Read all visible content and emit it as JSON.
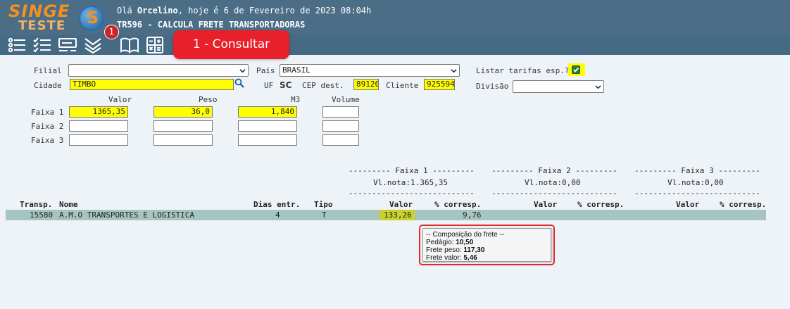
{
  "header": {
    "logo_line1": "SINGE",
    "logo_line2": "TESTE",
    "logo_letter": "S",
    "greeting_prefix": "Olá ",
    "user": "Orcelino",
    "greeting_suffix": ", hoje é 6 de Fevereiro de 2023 08:04h",
    "screen_title": "TR596 - CALCULA FRETE TRANSPORTADORAS"
  },
  "toolbar": {
    "icons": [
      "list-icon",
      "checklist-icon",
      "form-icon",
      "double-chevron-down-icon",
      "book-icon",
      "calculator-icon"
    ],
    "badge": "1",
    "consult_callout": "1 - Consultar"
  },
  "form": {
    "filial_label": "Filial",
    "filial_value": "",
    "pais_label": "País",
    "pais_value": "BRASIL",
    "listar_label": "Listar tarifas esp.?",
    "listar_checked": true,
    "cidade_label": "Cidade",
    "cidade_value": "TIMBO",
    "uf_label": "UF",
    "uf_value": "SC",
    "cep_label": "CEP dest.",
    "cep_value": "89120",
    "cliente_label": "Cliente",
    "cliente_value": "925594",
    "divisao_label": "Divisão",
    "divisao_value": "",
    "col_valor": "Valor",
    "col_peso": "Peso",
    "col_m3": "M3",
    "col_volume": "Volume",
    "faixas": [
      {
        "label": "Faixa 1",
        "valor": "1365,35",
        "peso": "36,0",
        "m3": "1,840",
        "volume": ""
      },
      {
        "label": "Faixa 2",
        "valor": "",
        "peso": "",
        "m3": "",
        "volume": ""
      },
      {
        "label": "Faixa 3",
        "valor": "",
        "peso": "",
        "m3": "",
        "volume": ""
      }
    ]
  },
  "summary": {
    "faixa1_title": "--------- Faixa 1 ---------",
    "faixa2_title": "--------- Faixa 2 ---------",
    "faixa3_title": "--------- Faixa 3 ---------",
    "faixa1_vlnota": "Vl.nota:1.365,35",
    "faixa2_vlnota": "Vl.nota:0,00",
    "faixa3_vlnota": "Vl.nota:0,00",
    "separator": "---------------------------"
  },
  "table": {
    "headers": {
      "transp": "Transp.",
      "nome": "Nome",
      "dias": "Dias entr.",
      "tipo": "Tipo",
      "valor1": "Valor",
      "corresp1": "% corresp.",
      "valor2": "Valor",
      "corresp2": "% corresp.",
      "valor3": "Valor",
      "corresp3": "% corresp."
    },
    "rows": [
      {
        "transp": "15580",
        "nome": "A.M.O TRANSPORTES E LOGISTICA",
        "dias": "4",
        "tipo": "T",
        "valor1": "133,26",
        "corresp1": "9,76"
      }
    ]
  },
  "composition": {
    "title": "-- Composição do frete --",
    "pedagio_label": "Pedágio: ",
    "pedagio_value": "10,50",
    "frete_peso_label": "Frete peso: ",
    "frete_peso_value": "117,30",
    "frete_valor_label": "Frete valor: ",
    "frete_valor_value": "5,46"
  },
  "colors": {
    "header_bg": "#4b6e86",
    "highlight_yellow": "#ffff00",
    "row_bg": "#a6c5c0",
    "callout_red": "#e8202a"
  }
}
